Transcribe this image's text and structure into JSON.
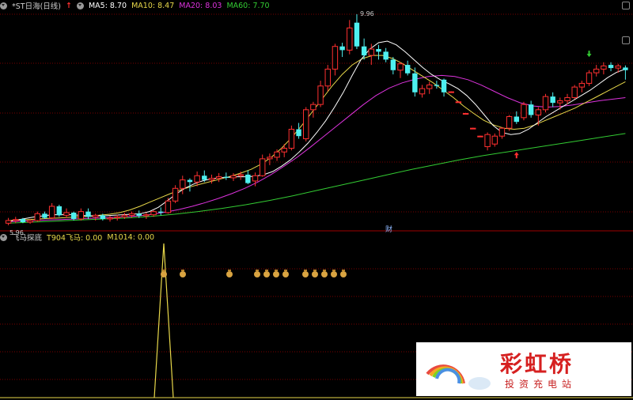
{
  "main_panel": {
    "title": "*ST日海(日线)",
    "indicators": [
      {
        "label": "MA5: 8.70",
        "color": "#ffffff"
      },
      {
        "label": "MA10: 8.47",
        "color": "#e8d84a"
      },
      {
        "label": "MA20: 8.03",
        "color": "#dd33dd"
      },
      {
        "label": "MA60: 7.70",
        "color": "#33cc33"
      }
    ],
    "high_label": "9.96",
    "low_label": "5.96",
    "financial_marker": "财"
  },
  "sub_panel": {
    "title": "飞马探底",
    "indicators": [
      {
        "label": "T904飞马: 0.00",
        "color": "#e8d84a"
      },
      {
        "label": "M1014: 0.00",
        "color": "#e8d84a"
      }
    ]
  },
  "watermark": {
    "name": "彩虹桥",
    "subtitle": "投资充电站"
  },
  "colors": {
    "up_candle": "#ff3030",
    "down_candle": "#4ef0f0",
    "ma5": "#ffffff",
    "ma10": "#e8d84a",
    "ma20": "#dd33dd",
    "ma60": "#33cc33",
    "grid": "#7a0000"
  },
  "chart_data": {
    "type": "candlestick",
    "price_range": [
      5.96,
      9.96
    ],
    "candles": [
      [
        6.0,
        6.1,
        5.96,
        6.05
      ],
      [
        6.05,
        6.12,
        6.0,
        6.07
      ],
      [
        6.08,
        6.1,
        6.0,
        6.02
      ],
      [
        6.02,
        6.08,
        5.99,
        6.05
      ],
      [
        6.05,
        6.22,
        6.03,
        6.18
      ],
      [
        6.18,
        6.22,
        6.08,
        6.1
      ],
      [
        6.1,
        6.38,
        6.08,
        6.32
      ],
      [
        6.32,
        6.35,
        6.12,
        6.15
      ],
      [
        6.15,
        6.28,
        6.1,
        6.2
      ],
      [
        6.2,
        6.22,
        6.05,
        6.08
      ],
      [
        6.08,
        6.28,
        6.05,
        6.22
      ],
      [
        6.22,
        6.28,
        6.08,
        6.12
      ],
      [
        6.12,
        6.18,
        6.05,
        6.15
      ],
      [
        6.15,
        6.18,
        6.05,
        6.08
      ],
      [
        6.08,
        6.14,
        6.03,
        6.1
      ],
      [
        6.1,
        6.16,
        6.05,
        6.12
      ],
      [
        6.12,
        6.2,
        6.08,
        6.15
      ],
      [
        6.15,
        6.22,
        6.1,
        6.18
      ],
      [
        6.18,
        6.24,
        6.1,
        6.14
      ],
      [
        6.14,
        6.2,
        6.08,
        6.16
      ],
      [
        6.16,
        6.25,
        6.12,
        6.22
      ],
      [
        6.22,
        6.3,
        6.15,
        6.2
      ],
      [
        6.2,
        6.48,
        6.18,
        6.42
      ],
      [
        6.42,
        6.72,
        6.38,
        6.66
      ],
      [
        6.66,
        6.9,
        6.55,
        6.82
      ],
      [
        6.82,
        6.85,
        6.6,
        6.78
      ],
      [
        6.78,
        6.98,
        6.7,
        6.9
      ],
      [
        6.9,
        7.0,
        6.78,
        6.82
      ],
      [
        6.82,
        6.92,
        6.75,
        6.85
      ],
      [
        6.85,
        6.95,
        6.78,
        6.88
      ],
      [
        6.88,
        6.96,
        6.82,
        6.86
      ],
      [
        6.86,
        6.95,
        6.8,
        6.9
      ],
      [
        6.9,
        6.98,
        6.82,
        6.92
      ],
      [
        6.92,
        7.0,
        6.74,
        6.76
      ],
      [
        6.8,
        6.96,
        6.7,
        6.9
      ],
      [
        6.9,
        7.3,
        6.88,
        7.22
      ],
      [
        7.22,
        7.32,
        7.1,
        7.25
      ],
      [
        7.25,
        7.4,
        7.18,
        7.35
      ],
      [
        7.35,
        7.5,
        7.25,
        7.42
      ],
      [
        7.42,
        7.85,
        7.38,
        7.78
      ],
      [
        7.78,
        7.9,
        7.6,
        7.65
      ],
      [
        7.6,
        8.2,
        7.55,
        8.15
      ],
      [
        8.15,
        8.3,
        8.0,
        8.25
      ],
      [
        8.25,
        8.7,
        8.2,
        8.6
      ],
      [
        8.6,
        9.0,
        8.5,
        8.92
      ],
      [
        8.92,
        9.4,
        8.8,
        9.35
      ],
      [
        9.35,
        9.42,
        9.15,
        9.28
      ],
      [
        9.28,
        9.85,
        9.2,
        9.7
      ],
      [
        9.8,
        9.96,
        9.3,
        9.35
      ],
      [
        9.35,
        9.5,
        9.1,
        9.18
      ],
      [
        9.18,
        9.4,
        9.0,
        9.3
      ],
      [
        9.3,
        9.38,
        9.1,
        9.25
      ],
      [
        9.25,
        9.32,
        9.05,
        9.1
      ],
      [
        9.1,
        9.15,
        8.82,
        8.9
      ],
      [
        8.9,
        9.05,
        8.75,
        9.02
      ],
      [
        9.0,
        9.08,
        8.8,
        8.84
      ],
      [
        8.84,
        8.95,
        8.4,
        8.48
      ],
      [
        8.45,
        8.62,
        8.38,
        8.55
      ],
      [
        8.55,
        8.68,
        8.45,
        8.62
      ],
      [
        8.62,
        8.7,
        8.55,
        8.6
      ],
      [
        8.72,
        8.74,
        8.4,
        8.48
      ],
      [
        8.48,
        8.5,
        8.48,
        8.49
      ],
      [
        8.3,
        8.31,
        8.29,
        8.3
      ],
      [
        8.08,
        8.09,
        8.07,
        8.08
      ],
      [
        7.8,
        7.81,
        7.79,
        7.8
      ],
      [
        7.65,
        7.66,
        7.64,
        7.65
      ],
      [
        7.45,
        7.72,
        7.38,
        7.68
      ],
      [
        7.5,
        7.7,
        7.45,
        7.65
      ],
      [
        7.65,
        7.82,
        7.6,
        7.8
      ],
      [
        7.8,
        8.05,
        7.75,
        8.02
      ],
      [
        8.02,
        8.12,
        7.88,
        7.92
      ],
      [
        8.0,
        8.3,
        7.95,
        8.25
      ],
      [
        8.25,
        8.32,
        8.0,
        8.05
      ],
      [
        8.05,
        8.2,
        7.85,
        8.15
      ],
      [
        8.15,
        8.45,
        8.1,
        8.4
      ],
      [
        8.4,
        8.48,
        8.2,
        8.28
      ],
      [
        8.28,
        8.38,
        8.15,
        8.32
      ],
      [
        8.32,
        8.45,
        8.25,
        8.38
      ],
      [
        8.38,
        8.62,
        8.35,
        8.58
      ],
      [
        8.58,
        8.7,
        8.48,
        8.65
      ],
      [
        8.65,
        8.9,
        8.6,
        8.85
      ],
      [
        8.85,
        9.0,
        8.78,
        8.92
      ],
      [
        8.92,
        9.05,
        8.82,
        8.98
      ],
      [
        9.0,
        9.05,
        8.88,
        8.94
      ],
      [
        8.94,
        9.02,
        8.85,
        8.98
      ],
      [
        8.95,
        8.99,
        8.72,
        8.9
      ]
    ],
    "ma_lines": {
      "ma5": [
        6.03,
        6.06,
        6.09,
        6.12,
        6.14,
        6.16,
        6.16,
        6.16,
        6.15,
        6.14,
        6.14,
        6.14,
        6.15,
        6.16,
        6.17,
        6.18,
        6.22,
        6.3,
        6.42,
        6.55,
        6.66,
        6.74,
        6.8,
        6.84,
        6.86,
        6.87,
        6.88,
        6.88,
        6.89,
        6.92,
        6.98,
        7.08,
        7.2,
        7.35,
        7.52,
        7.72,
        7.94,
        8.2,
        8.48,
        8.8,
        9.1,
        9.3,
        9.42,
        9.45,
        9.38,
        9.25,
        9.1,
        8.95,
        8.82,
        8.72,
        8.64,
        8.55,
        8.42,
        8.25,
        8.05,
        7.85,
        7.72,
        7.68,
        7.7,
        7.78,
        7.9,
        8.02,
        8.12,
        8.22,
        8.32,
        8.42,
        8.52,
        8.64,
        8.76,
        8.86,
        8.92
      ],
      "ma10": [
        6.05,
        6.06,
        6.07,
        6.08,
        6.09,
        6.1,
        6.11,
        6.12,
        6.13,
        6.15,
        6.17,
        6.2,
        6.25,
        6.32,
        6.4,
        6.48,
        6.56,
        6.63,
        6.69,
        6.74,
        6.79,
        6.84,
        6.89,
        6.95,
        7.02,
        7.12,
        7.25,
        7.42,
        7.62,
        7.85,
        8.1,
        8.35,
        8.6,
        8.82,
        9.0,
        9.12,
        9.18,
        9.18,
        9.12,
        9.02,
        8.9,
        8.78,
        8.66,
        8.52,
        8.38,
        8.22,
        8.08,
        7.95,
        7.86,
        7.8,
        7.78,
        7.8,
        7.86,
        7.94,
        8.02,
        8.1,
        8.18,
        8.28,
        8.38,
        8.48,
        8.58,
        8.68
      ],
      "ma20": [
        6.03,
        6.04,
        6.05,
        6.06,
        6.07,
        6.08,
        6.09,
        6.1,
        6.11,
        6.12,
        6.14,
        6.17,
        6.21,
        6.26,
        6.32,
        6.39,
        6.47,
        6.56,
        6.66,
        6.78,
        6.92,
        7.08,
        7.25,
        7.44,
        7.64,
        7.84,
        8.04,
        8.24,
        8.42,
        8.56,
        8.66,
        8.73,
        8.78,
        8.8,
        8.78,
        8.72,
        8.62,
        8.5,
        8.38,
        8.28,
        8.22,
        8.2,
        8.21,
        8.24,
        8.28,
        8.32,
        8.35,
        8.38
      ],
      "ma60": [
        6.0,
        6.02,
        6.04,
        6.06,
        6.08,
        6.1,
        6.13,
        6.17,
        6.22,
        6.28,
        6.35,
        6.43,
        6.52,
        6.62,
        6.72,
        6.82,
        6.92,
        7.02,
        7.11,
        7.2,
        7.28,
        7.35,
        7.42,
        7.49,
        7.56,
        7.63,
        7.7
      ]
    },
    "signals": [
      {
        "index": 17,
        "row": 1
      },
      {
        "index": 19,
        "row": 1
      },
      {
        "index": 24,
        "row": 1
      },
      {
        "index": 27,
        "row": 1
      },
      {
        "index": 28,
        "row": 1
      },
      {
        "index": 29,
        "row": 1
      },
      {
        "index": 30,
        "row": 1
      },
      {
        "index": 32,
        "row": 1
      },
      {
        "index": 33,
        "row": 1
      },
      {
        "index": 34,
        "row": 1
      },
      {
        "index": 35,
        "row": 1
      },
      {
        "index": 36,
        "row": 1
      }
    ],
    "sub_spike_index": 17
  }
}
